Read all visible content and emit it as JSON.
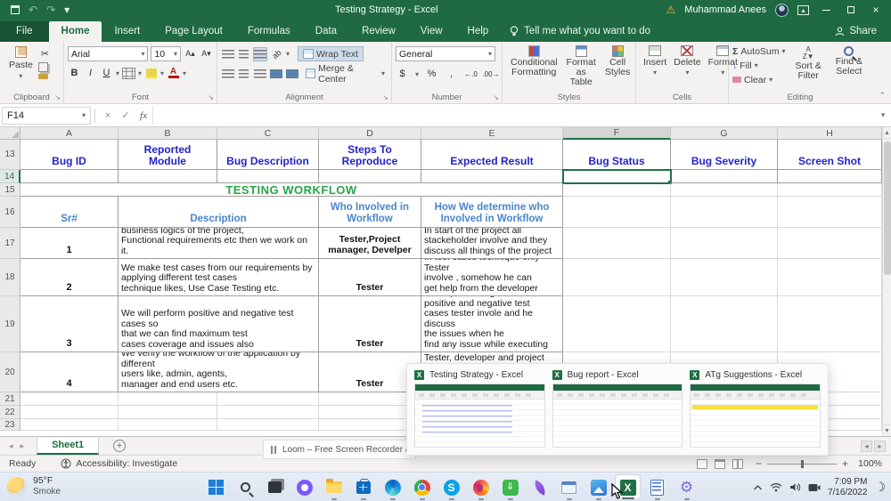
{
  "titlebar": {
    "title": "Testing Strategy  -  Excel",
    "user": "Muhammad Anees"
  },
  "ribbon": {
    "tabs": [
      {
        "label": "File"
      },
      {
        "label": "Home"
      },
      {
        "label": "Insert"
      },
      {
        "label": "Page Layout"
      },
      {
        "label": "Formulas"
      },
      {
        "label": "Data"
      },
      {
        "label": "Review"
      },
      {
        "label": "View"
      },
      {
        "label": "Help"
      }
    ],
    "tell_me": "Tell me what you want to do",
    "share": "Share",
    "clipboard": {
      "paste": "Paste",
      "group": "Clipboard"
    },
    "font": {
      "name": "Arial",
      "size": "10",
      "group": "Font"
    },
    "alignment": {
      "wrap": "Wrap Text",
      "merge": "Merge & Center",
      "group": "Alignment"
    },
    "number": {
      "format": "General",
      "group": "Number"
    },
    "styles": {
      "conditional": "Conditional\nFormatting",
      "format_table": "Format as\nTable",
      "cell_styles": "Cell\nStyles",
      "group": "Styles"
    },
    "cells": {
      "insert": "Insert",
      "delete": "Delete",
      "format": "Format",
      "group": "Cells"
    },
    "editing": {
      "autosum": "AutoSum",
      "fill": "Fill",
      "clear": "Clear",
      "sort": "Sort &\nFilter",
      "find": "Find &\nSelect",
      "group": "Editing"
    }
  },
  "formula_bar": {
    "name_box": "F14",
    "value": ""
  },
  "grid": {
    "col_letters": [
      "A",
      "B",
      "C",
      "D",
      "E",
      "F",
      "G",
      "H"
    ],
    "row_numbers": [
      "13",
      "14",
      "15",
      "16",
      "17",
      "18",
      "19",
      "20",
      "21",
      "22",
      "23"
    ],
    "bug_headers": {
      "a": "Bug ID",
      "b": "Reported\nModule",
      "c": "Bug Description",
      "d": "Steps To\nReproduce",
      "e": "Expected Result",
      "f": "Bug Status",
      "g": "Bug Severity",
      "h": "Screen Shot"
    },
    "section_title": "TESTING WORKFLOW",
    "wf_headers": {
      "sr": "Sr#",
      "desc": "Description",
      "who": "Who Involved in\nWorkflow",
      "how": "How We determine who\nInvolved in Workflow"
    },
    "rows": [
      {
        "sr": "1",
        "desc": "First we will understand the requirements and main\nbusiness logics of the project,\nFunctional requirements etc then we work on it.",
        "who": "Tester,Project\nmanager, Develper",
        "how": "In start of the project all\nstackeholder involve and they\ndiscuss all things of the project"
      },
      {
        "sr": "2",
        "desc": "We make test cases from our requirements by\napplying different test cases\ntechnique likes, Use Case Testing etc.",
        "who": "Tester",
        "how": "In test cases technique only Tester\ninvolve , somehow he can\nget help from the developer"
      },
      {
        "sr": "3",
        "desc": "We will perform positive and negative test cases so\nthat we can find maximum test\ncases coverage and issues also",
        "who": "Tester",
        "how": "While performing the test cases\npositive and negative test\ncases tester invole and he discuss\nthe issues when he\nfind any issue while executing"
      },
      {
        "sr": "4",
        "desc": "We verify the workflow of the application by different\nusers like, admin, agents,\nmanager and end users etc.",
        "who": "Tester",
        "how": "Tester, developer and project"
      }
    ]
  },
  "sheet_bar": {
    "active_tab": "Sheet1"
  },
  "status_bar": {
    "ready": "Ready",
    "accessibility": "Accessibility: Investigate",
    "zoom": "100%"
  },
  "loom_bar": {
    "label": "Loom – Free Screen Recorder & Scre"
  },
  "preview_popup": [
    {
      "title": "Testing Strategy - Excel"
    },
    {
      "title": "Bug report - Excel"
    },
    {
      "title": "ATg Suggestions - Excel"
    }
  ],
  "taskbar": {
    "weather_temp": "95°F",
    "weather_cond": "Smoke",
    "time": "7:09 PM",
    "date": "7/16/2022"
  },
  "icons": {
    "undo": "↶",
    "redo": "↷",
    "chev": "▾",
    "up": "▴",
    "left": "◂",
    "right": "▸",
    "sigma": "Σ",
    "fx": "fx",
    "check": "✓",
    "x": "×",
    "bold": "B",
    "italic": "I",
    "underline": "U",
    "dollar": "$",
    "percent": "%",
    "comma": ",",
    "dec_inc": "←.0",
    "dec_dec": ".00→",
    "warning": "⚠",
    "gear": "⚙",
    "moon": "☽",
    "scissors": "✂",
    "plus": "+",
    "minus": "−",
    "grow": "A▴",
    "shrink": "A▾",
    "skype_s": "S",
    "idm_arrow": "⇓",
    "excel_x": "X",
    "store_chev": "^",
    "pencil": "✎",
    "eraser": "⌫",
    "fill_arrow": "↓",
    "sort_az": "A↓Z",
    "bulb": "💡"
  }
}
